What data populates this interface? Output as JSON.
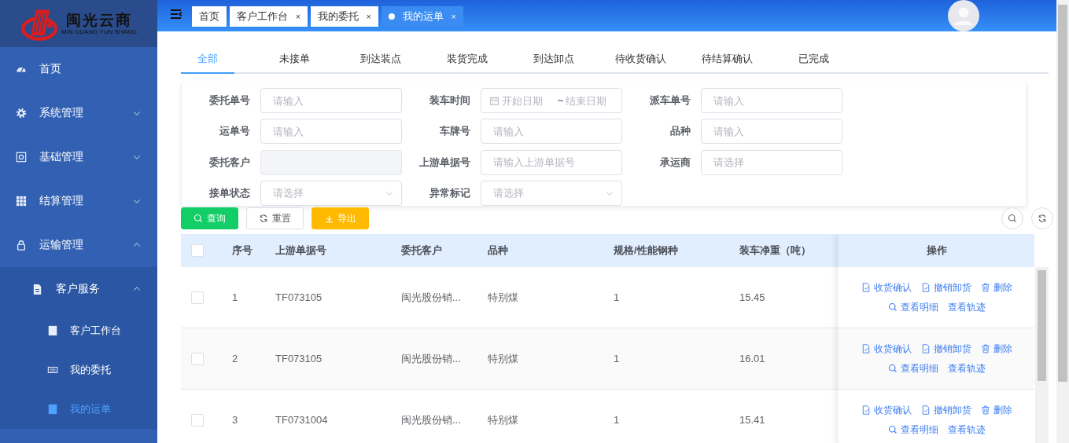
{
  "logo": {
    "title": "闽光云商",
    "subtitle": "MIN GUANG YUN SHANG"
  },
  "sidebar": {
    "items": [
      {
        "label": "首页",
        "selected": false
      },
      {
        "label": "系统管理",
        "expanded": false,
        "selected": false
      },
      {
        "label": "基础管理",
        "expanded": false,
        "selected": false
      },
      {
        "label": "结算管理",
        "expanded": false,
        "selected": false
      },
      {
        "label": "运输管理",
        "expanded": true,
        "selected": false,
        "children": [
          {
            "label": "客户服务",
            "expanded": true,
            "selected": false,
            "children": [
              {
                "label": "客户工作台",
                "selected": false
              },
              {
                "label": "我的委托",
                "selected": false
              },
              {
                "label": "我的运单",
                "selected": true
              }
            ]
          }
        ]
      }
    ]
  },
  "page_tabs": [
    {
      "label": "首页",
      "selected": false
    },
    {
      "label": "客户工作台",
      "close": "×",
      "selected": false
    },
    {
      "label": "我的委托",
      "close": "×",
      "selected": false
    },
    {
      "label": "我的运单",
      "close": "×",
      "selected": true
    }
  ],
  "status_tabs": [
    {
      "label": "全部",
      "selected": true
    },
    {
      "label": "未接单",
      "selected": false
    },
    {
      "label": "到达装点",
      "selected": false
    },
    {
      "label": "装货完成",
      "selected": false
    },
    {
      "label": "到达卸点",
      "selected": false
    },
    {
      "label": "待收货确认",
      "selected": false
    },
    {
      "label": "待结算确认",
      "selected": false
    },
    {
      "label": "已完成",
      "selected": false
    }
  ],
  "filters": [
    {
      "label": "委托单号",
      "kind": "input",
      "placeholder": "请输入",
      "disabled": false
    },
    {
      "label": "装车时间",
      "kind": "daterange",
      "start_placeholder": "开始日期",
      "separator": "~",
      "end_placeholder": "结束日期",
      "disabled": false
    },
    {
      "label": "派车单号",
      "kind": "input",
      "placeholder": "请输入",
      "disabled": false
    },
    {
      "label": "运单号",
      "kind": "input",
      "placeholder": "请输入",
      "disabled": false
    },
    {
      "label": "车牌号",
      "kind": "input",
      "placeholder": "请输入",
      "disabled": false
    },
    {
      "label": "品种",
      "kind": "input",
      "placeholder": "请输入",
      "disabled": false
    },
    {
      "label": "委托客户",
      "kind": "input",
      "disabled": true
    },
    {
      "label": "上游单据号",
      "kind": "input",
      "placeholder": "请输入上游单据号",
      "disabled": false
    },
    {
      "label": "承运商",
      "kind": "input",
      "placeholder": "请选择",
      "disabled": false
    },
    {
      "label": "接单状态",
      "kind": "select",
      "placeholder": "请选择",
      "disabled": false
    },
    {
      "label": "异常标记",
      "kind": "select",
      "placeholder": "请选择",
      "disabled": false
    }
  ],
  "buttons": [
    {
      "label": "查询",
      "kind": "primary"
    },
    {
      "label": "重置",
      "kind": "default"
    },
    {
      "label": "导出",
      "kind": "warning"
    }
  ],
  "table": {
    "select_all": {
      "checked": false
    },
    "columns": [
      "序号",
      "上游单据号",
      "委托客户",
      "品种",
      "规格/性能钢种",
      "装车净重（吨）"
    ],
    "action_column": "操作",
    "rows": [
      {
        "checked": false,
        "cells": [
          "1",
          "TF073105",
          "闽光股份销...",
          "特别煤",
          "1",
          "15.45"
        ],
        "actions": [
          "收货确认",
          "撤销卸货",
          "删除",
          "查看明细",
          "查看轨迹"
        ]
      },
      {
        "checked": false,
        "cells": [
          "2",
          "TF073105",
          "闽光股份销...",
          "特别煤",
          "1",
          "16.01"
        ],
        "actions": [
          "收货确认",
          "撤销卸货",
          "删除",
          "查看明细",
          "查看轨迹"
        ]
      },
      {
        "checked": false,
        "cells": [
          "3",
          "TF0731004",
          "闽光股份销...",
          "特别煤",
          "1",
          "15.41"
        ],
        "actions": [
          "收货确认",
          "撤销卸货",
          "删除",
          "查看明细",
          "查看轨迹"
        ]
      }
    ]
  }
}
